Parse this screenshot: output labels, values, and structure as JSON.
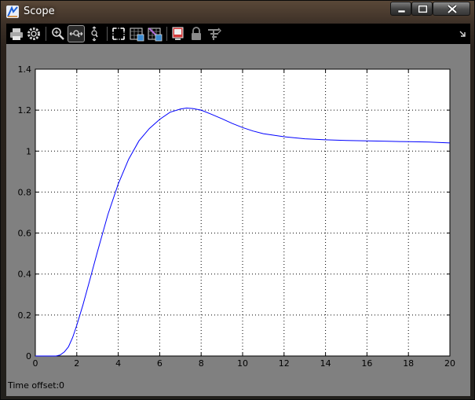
{
  "window": {
    "title": "Scope"
  },
  "toolbar": {
    "buttons": [
      "print-icon",
      "parameters-icon",
      "zoom-in-icon",
      "zoom-x-icon",
      "zoom-y-icon",
      "autoscale-icon",
      "save-axes-settings-icon",
      "restore-axes-settings-icon",
      "floating-scope-icon",
      "lock-axes-icon",
      "signal-selection-icon"
    ],
    "active": "zoom-x-icon"
  },
  "footer": {
    "time_offset_label": "Time offset:",
    "time_offset_value": "0"
  },
  "colors": {
    "line": "#0000ff",
    "plot_bg": "#ffffff",
    "client_bg": "#808080",
    "toolbar_bg": "#000000"
  },
  "chart_data": {
    "type": "line",
    "title": "",
    "xlabel": "",
    "ylabel": "",
    "xlim": [
      0,
      20
    ],
    "ylim": [
      0,
      1.4
    ],
    "xticks": [
      "0",
      "2",
      "4",
      "6",
      "8",
      "10",
      "12",
      "14",
      "16",
      "18",
      "20"
    ],
    "yticks": [
      "0",
      "0.2",
      "0.4",
      "0.6",
      "0.8",
      "1",
      "1.2",
      "1.4"
    ],
    "grid": true,
    "series": [
      {
        "x": [
          0,
          1.0,
          1.2,
          1.4,
          1.6,
          1.8,
          2.0,
          2.3,
          2.6,
          3.0,
          3.5,
          4.0,
          4.5,
          5.0,
          5.5,
          6.0,
          6.5,
          7.0,
          7.3,
          7.6,
          8.0,
          8.5,
          9.0,
          9.5,
          10.0,
          10.5,
          11.0,
          12.0,
          13.0,
          14.0,
          15.0,
          16.0,
          17.0,
          18.0,
          19.0,
          20.0
        ],
        "y": [
          0,
          0,
          0.005,
          0.02,
          0.045,
          0.09,
          0.15,
          0.25,
          0.36,
          0.51,
          0.69,
          0.84,
          0.96,
          1.05,
          1.11,
          1.155,
          1.19,
          1.205,
          1.21,
          1.208,
          1.2,
          1.18,
          1.158,
          1.135,
          1.115,
          1.098,
          1.085,
          1.07,
          1.06,
          1.055,
          1.052,
          1.05,
          1.048,
          1.046,
          1.044,
          1.04
        ]
      }
    ]
  }
}
